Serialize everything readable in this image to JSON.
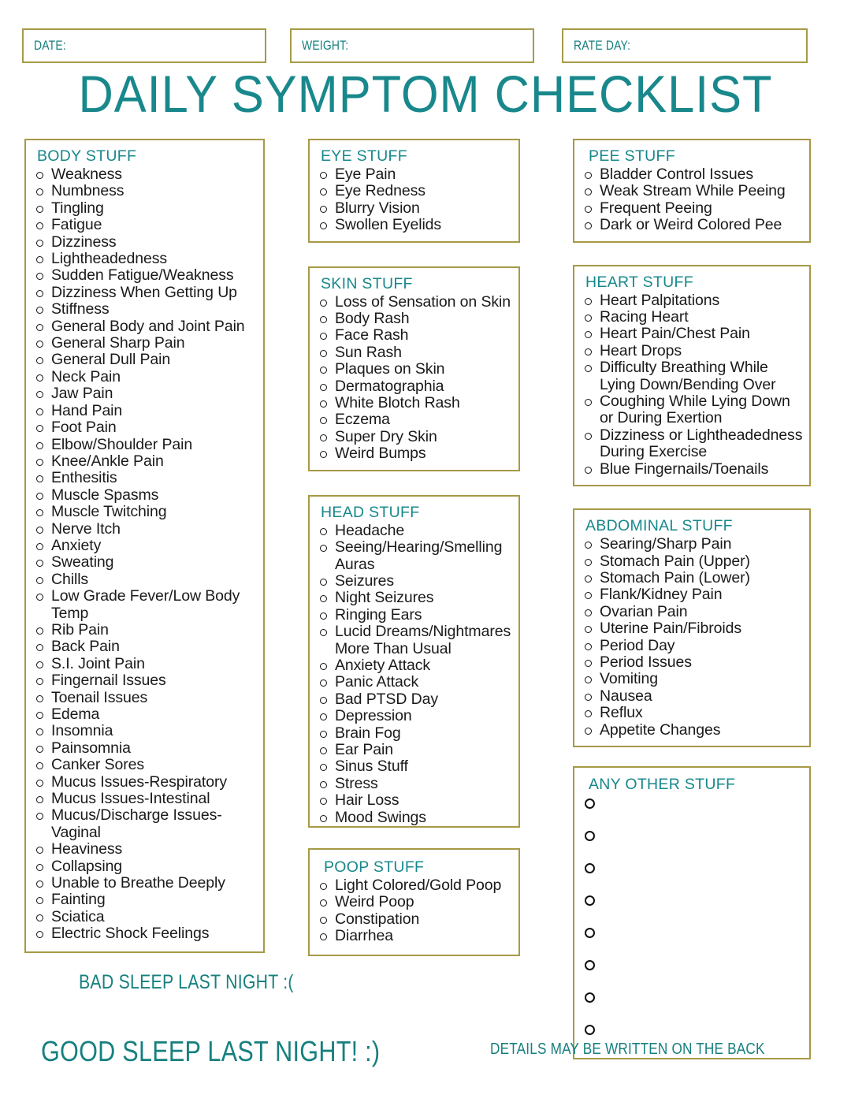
{
  "header": {
    "fields": [
      {
        "label": "DATE:"
      },
      {
        "label": "WEIGHT:"
      },
      {
        "label": "RATE DAY:"
      }
    ],
    "title": "DAILY SYMPTOM CHECKLIST"
  },
  "colors": {
    "teal": "#17807f",
    "border_olive": "#a69a46",
    "text": "#1a1a1a"
  },
  "columns": [
    {
      "sections": [
        {
          "title": "BODY STUFF",
          "items": [
            "Weakness",
            "Numbness",
            "Tingling",
            "Fatigue",
            "Dizziness",
            "Lightheadedness",
            "Sudden Fatigue/Weakness",
            "Dizziness When Getting Up",
            "Stiffness",
            "General Body and Joint Pain",
            "General Sharp Pain",
            "General Dull Pain",
            "Neck Pain",
            "Jaw Pain",
            "Hand Pain",
            "Foot Pain",
            "Elbow/Shoulder Pain",
            "Knee/Ankle Pain",
            "Enthesitis",
            "Muscle Spasms",
            "Muscle Twitching",
            "Nerve Itch",
            "Anxiety",
            "Sweating",
            "Chills",
            "Low Grade Fever/Low Body Temp",
            "Rib Pain",
            "Back Pain",
            "S.I. Joint Pain",
            "Fingernail Issues",
            "Toenail Issues",
            "Edema",
            "Insomnia",
            "Painsomnia",
            "Canker Sores",
            "Mucus Issues-Respiratory",
            "Mucus Issues-Intestinal",
            "Mucus/Discharge Issues-Vaginal",
            "Heaviness",
            "Collapsing",
            "Unable to Breathe Deeply",
            "Fainting",
            "Sciatica",
            "Electric Shock Feelings"
          ]
        }
      ]
    },
    {
      "sections": [
        {
          "title": "EYE STUFF",
          "items": [
            "Eye Pain",
            "Eye Redness",
            "Blurry Vision",
            "Swollen Eyelids"
          ]
        },
        {
          "title": "SKIN STUFF",
          "items": [
            "Loss of Sensation on Skin",
            "Body Rash",
            "Face Rash",
            "Sun Rash",
            "Plaques on Skin",
            "Dermatographia",
            "White Blotch Rash",
            "Eczema",
            "Super Dry Skin",
            "Weird Bumps"
          ]
        },
        {
          "title": "HEAD STUFF",
          "items": [
            "Headache",
            "Seeing/Hearing/Smelling Auras",
            "Seizures",
            "Night Seizures",
            "Ringing Ears",
            "Lucid Dreams/Nightmares More Than Usual",
            "Anxiety Attack",
            "Panic Attack",
            "Bad PTSD Day",
            "Depression",
            "Brain Fog",
            "Ear Pain",
            "Sinus Stuff",
            "Stress",
            "Hair Loss",
            "Mood Swings"
          ]
        },
        {
          "title": "POOP STUFF",
          "items": [
            "Light Colored/Gold Poop",
            "Weird Poop",
            "Constipation",
            "Diarrhea"
          ]
        }
      ]
    },
    {
      "sections": [
        {
          "title": "PEE STUFF",
          "items": [
            "Bladder Control Issues",
            "Weak Stream While Peeing",
            "Frequent Peeing",
            "Dark or Weird Colored Pee"
          ]
        },
        {
          "title": "HEART STUFF",
          "items": [
            "Heart Palpitations",
            "Racing Heart",
            "Heart Pain/Chest Pain",
            "Heart Drops",
            "Difficulty Breathing While Lying Down/Bending Over",
            "Coughing While Lying Down or During Exertion",
            "Dizziness or Lightheadedness During Exercise",
            "Blue Fingernails/Toenails"
          ]
        },
        {
          "title": "ABDOMINAL STUFF",
          "items": [
            "Searing/Sharp Pain",
            "Stomach Pain (Upper)",
            "Stomach Pain (Lower)",
            "Flank/Kidney Pain",
            "Ovarian Pain",
            "Uterine Pain/Fibroids",
            "Period Day",
            "Period Issues",
            "Vomiting",
            "Nausea",
            "Reflux",
            "Appetite Changes"
          ]
        },
        {
          "title": "ANY OTHER STUFF",
          "blank_rows": 8
        }
      ]
    }
  ],
  "footer": {
    "bad_sleep": "BAD SLEEP LAST NIGHT   :(",
    "good_sleep": "GOOD SLEEP LAST NIGHT!  :)",
    "note": "DETAILS MAY BE WRITTEN ON THE BACK"
  }
}
